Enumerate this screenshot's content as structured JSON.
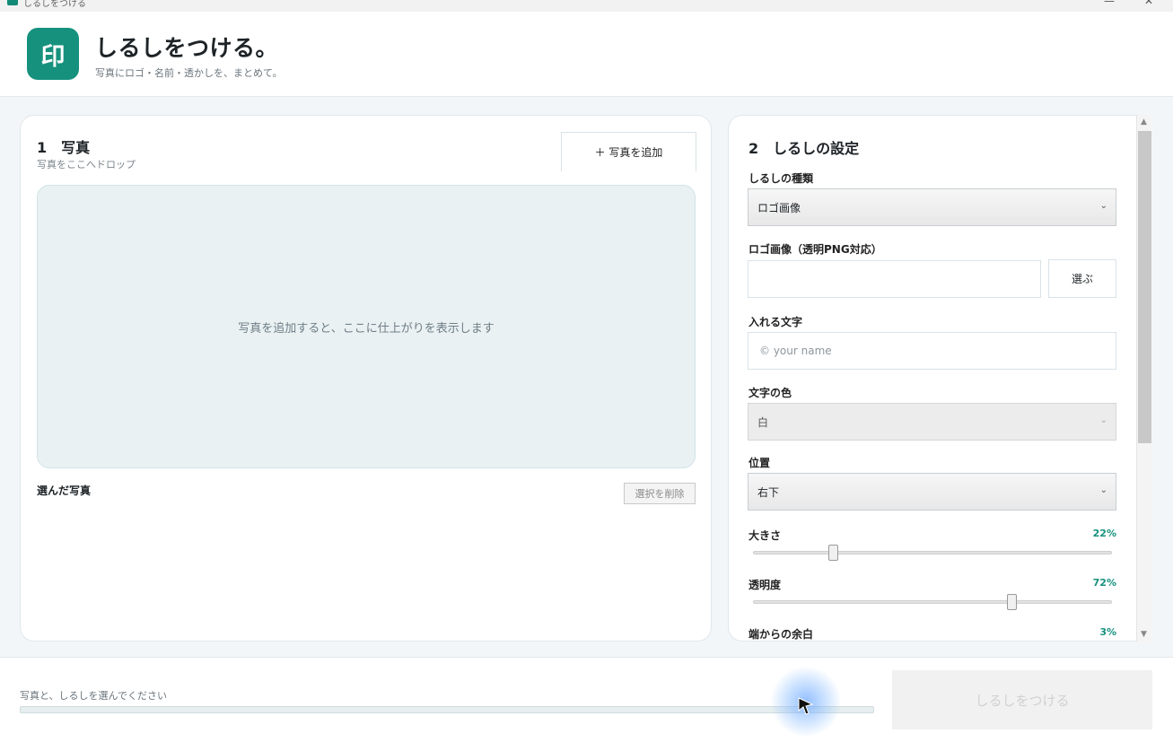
{
  "window": {
    "title": "しるしをつける",
    "minimize": "—",
    "close": "✕"
  },
  "header": {
    "logo_char": "印",
    "app_name": "しるしをつける。",
    "subtitle": "写真にロゴ・名前・透かしを、まとめて。"
  },
  "left": {
    "title": "1　写真",
    "subtitle": "写真をここへドロップ",
    "add_button": "＋ 写真を追加",
    "drop_message": "写真を追加すると、ここに仕上がりを表示します",
    "selected_label": "選んだ写真",
    "delete_button": "選択を削除"
  },
  "right": {
    "title": "2　しるしの設定",
    "type_label": "しるしの種類",
    "type_value": "ロゴ画像",
    "logo_label": "ロゴ画像（透明PNG対応）",
    "logo_value": "",
    "choose_button": "選ぶ",
    "text_label": "入れる文字",
    "text_placeholder": "© your name",
    "color_label": "文字の色",
    "color_value": "白",
    "position_label": "位置",
    "position_value": "右下",
    "size_label": "大きさ",
    "size_value": "22%",
    "size_level": 0.22,
    "opacity_label": "透明度",
    "opacity_value": "72%",
    "opacity_level": 0.72,
    "margin_label": "端からの余白",
    "margin_value": "3%"
  },
  "footer": {
    "status": "写真と、しるしを選んでください",
    "progress": 0,
    "apply_button": "しるしをつける"
  },
  "colors": {
    "accent": "#16917d",
    "logo_bg": "#16917d",
    "drop_bg": "#e9f1f3"
  },
  "icons": {
    "chevron": "chevron-down-icon",
    "cursor": "pointer-cursor-icon"
  }
}
